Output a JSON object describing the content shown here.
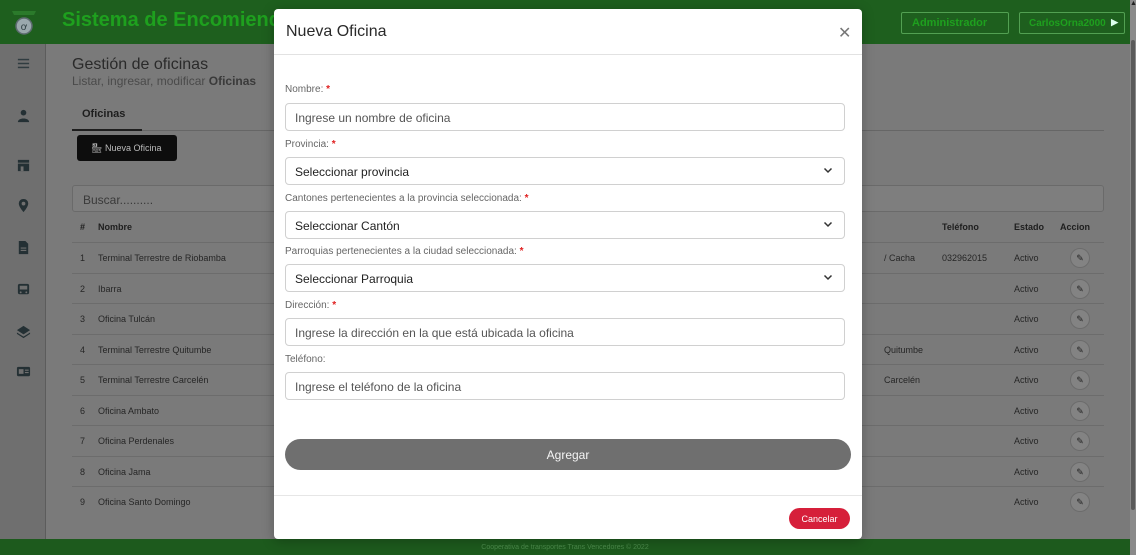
{
  "app": {
    "title": "Sistema de Encomiendas",
    "role_button": "Administrador",
    "user_button": "CarlosOrna2000",
    "footer": "Cooperativa de transportes Trans Vencedores © 2022"
  },
  "sidebar": {
    "icons": [
      "user-icon",
      "store-icon",
      "location-pin-icon",
      "document-icon",
      "bus-icon",
      "layers-icon",
      "id-card-icon"
    ]
  },
  "page": {
    "title": "Gestión de oficinas",
    "subtitle_prefix": "Listar, ingresar, modificar",
    "subtitle_bold": "Oficinas",
    "tab": "Oficinas",
    "new_button": "Nueva Oficina",
    "search_placeholder": "Buscar..........",
    "columns": {
      "num": "#",
      "name": "Nombre",
      "phone": "Teléfono",
      "status": "Estado",
      "action": "Accion"
    },
    "rows": [
      {
        "num": "1",
        "name": "Terminal Terrestre de Riobamba",
        "extra": "/ Cacha",
        "phone": "032962015",
        "status": "Activo"
      },
      {
        "num": "2",
        "name": "Ibarra",
        "extra": "",
        "phone": "",
        "status": "Activo"
      },
      {
        "num": "3",
        "name": "Oficina Tulcán",
        "extra": "",
        "phone": "",
        "status": "Activo"
      },
      {
        "num": "4",
        "name": "Terminal Terrestre Quitumbe",
        "extra": "Quitumbe",
        "phone": "",
        "status": "Activo"
      },
      {
        "num": "5",
        "name": "Terminal Terrestre Carcelén",
        "extra": "Carcelén",
        "phone": "",
        "status": "Activo"
      },
      {
        "num": "6",
        "name": "Oficina Ambato",
        "extra": "",
        "phone": "",
        "status": "Activo"
      },
      {
        "num": "7",
        "name": "Oficina Perdenales",
        "extra": "",
        "phone": "",
        "status": "Activo"
      },
      {
        "num": "8",
        "name": "Oficina Jama",
        "extra": "",
        "phone": "",
        "status": "Activo"
      },
      {
        "num": "9",
        "name": "Oficina Santo Domingo",
        "extra": "",
        "phone": "",
        "status": "Activo"
      }
    ]
  },
  "modal": {
    "title": "Nueva Oficina",
    "required_mark": "*",
    "fields": {
      "nombre": {
        "label": "Nombre:",
        "placeholder": "Ingrese un nombre de oficina"
      },
      "provincia": {
        "label": "Provincia:",
        "value": "Seleccionar provincia"
      },
      "canton": {
        "label": "Cantones pertenecientes a la provincia seleccionada:",
        "value": "Seleccionar Cantón"
      },
      "parroquia": {
        "label": "Parroquias pertenecientes a la ciudad seleccionada:",
        "value": "Seleccionar Parroquia"
      },
      "direccion": {
        "label": "Dirección:",
        "placeholder": "Ingrese la dirección en la que está ubicada la oficina"
      },
      "telefono": {
        "label": "Teléfono:",
        "placeholder": "Ingrese el teléfono de la oficina"
      }
    },
    "submit": "Agregar",
    "cancel": "Cancelar"
  },
  "colors": {
    "brand_green": "#1ea01e",
    "topbar_dark": "#1e5f1e",
    "cancel_red": "#d61f3a",
    "required_red": "#e02020",
    "submit_gray": "#6f6f6f"
  }
}
